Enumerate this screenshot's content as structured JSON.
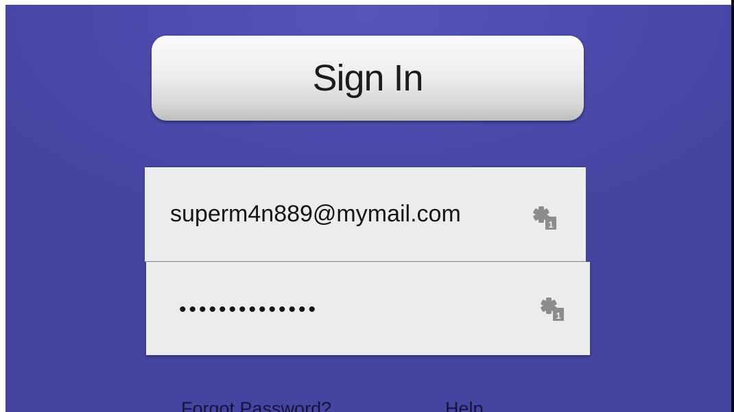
{
  "signin": {
    "button_label": "Sign In"
  },
  "form": {
    "email_value": "superm4n889@mymail.com",
    "password_value": "••••••••••••••",
    "keyboard_icon": "keyboard-shortcut-icon"
  },
  "footer": {
    "forgot_password_label": "Forgot Password?",
    "help_label": "Help"
  },
  "colors": {
    "background": "#4d4caf",
    "field_background": "#ececec",
    "button_background": "#e6e6e6",
    "text": "#151515"
  }
}
